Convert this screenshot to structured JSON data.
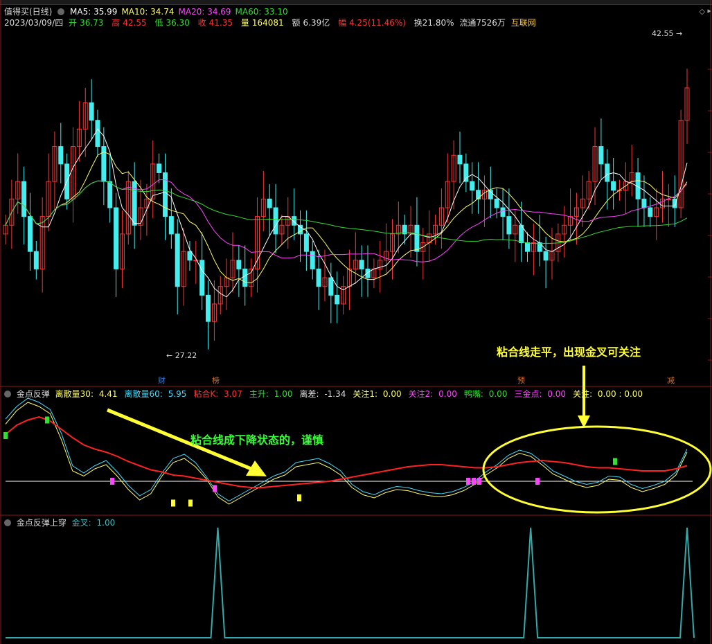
{
  "window": {
    "title": "值得买(日线)"
  },
  "ma_legend": [
    {
      "label": "MA5: 35.99",
      "color": "#ffffff"
    },
    {
      "label": "MA10: 34.74",
      "color": "#ffff66"
    },
    {
      "label": "MA20: 34.69",
      "color": "#ff44ff"
    },
    {
      "label": "MA60: 33.10",
      "color": "#33dd33"
    }
  ],
  "quote": {
    "date": "2023/03/09/四",
    "open_label": "开",
    "open": "36.73",
    "high_label": "高",
    "high": "42.55",
    "low_label": "低",
    "low": "36.30",
    "close_label": "收",
    "close": "41.35",
    "vol_label": "量",
    "vol": "164081",
    "amt_label": "额",
    "amt": "6.39亿",
    "chg_label": "幅",
    "chg": "4.25(11.46%)",
    "turnover": "换21.80%",
    "float": "流通7526万",
    "sector": "互联网"
  },
  "markers": {
    "max_price": "42.55",
    "min_price": "27.22"
  },
  "event_badges": [
    {
      "text": "财",
      "color": "#3a7bd5"
    },
    {
      "text": "榜",
      "color": "#d07030"
    },
    {
      "text": "预",
      "color": "#d07030"
    },
    {
      "text": "减",
      "color": "#d07030"
    }
  ],
  "indicator1": {
    "name": "金点反弹",
    "items": [
      {
        "label": "离散量30:",
        "value": "4.41",
        "color": "#ffff66"
      },
      {
        "label": "离散量60:",
        "value": "5.95",
        "color": "#44ddff"
      },
      {
        "label": "粘合K:",
        "value": "3.07",
        "color": "#ff3333"
      },
      {
        "label": "主升:",
        "value": "1.00",
        "color": "#33dd33"
      },
      {
        "label": "离差:",
        "value": "-1.34",
        "color": "#dddddd"
      },
      {
        "label": "关注1:",
        "value": "0.00",
        "color": "#ffff66"
      },
      {
        "label": "关注2:",
        "value": "0.00",
        "color": "#ff44ff"
      },
      {
        "label": "鸭嘴:",
        "value": "0.00",
        "color": "#33dd33"
      },
      {
        "label": "三金点:",
        "value": "0.00",
        "color": "#ff44ff"
      },
      {
        "label": "关注:",
        "value": "0.00 : 0.00",
        "color": "#ffff66"
      }
    ]
  },
  "indicator2": {
    "name": "金点反弹上穿",
    "items": [
      {
        "label": "金叉:",
        "value": "1.00",
        "color": "#44bbbb"
      }
    ]
  },
  "annotations": {
    "falling": "粘合线成下降状态的，谨慎",
    "flat": "粘合线走平，出现金叉可关注"
  },
  "colors": {
    "up": "#ff3333",
    "down": "#44eeee",
    "ma5": "#ffffff",
    "ma10": "#ffff66",
    "ma20": "#ff44ff",
    "ma60": "#33dd33",
    "ann_green": "#33ff33",
    "ann_yellow": "#ffff33"
  },
  "chart_data": [
    {
      "type": "candlestick",
      "title": "值得买(日线)",
      "ylim": [
        25,
        44
      ],
      "approx_closes": [
        33.5,
        35,
        36,
        34,
        32,
        31,
        34,
        36,
        38,
        37,
        35,
        38,
        39,
        40.5,
        39.5,
        38,
        36,
        34.5,
        31,
        33,
        36,
        33.5,
        34.5,
        35,
        37,
        36.5,
        34,
        33,
        30,
        32,
        31.5,
        31.5,
        29.5,
        28,
        29,
        30,
        30.5,
        31.5,
        31,
        30,
        31,
        34,
        35,
        34.5,
        33,
        33.5,
        34,
        33.5,
        33,
        32,
        31,
        30,
        30.5,
        29.5,
        29,
        30,
        31,
        31.5,
        31,
        30.5,
        31,
        31.5,
        32,
        33,
        33.5,
        33,
        33.5,
        32,
        32.5,
        33,
        33.5,
        34.5,
        36,
        37.5,
        37,
        36,
        35.5,
        35,
        35.5,
        35,
        34.5,
        34,
        33,
        33.5,
        32.5,
        32,
        32.5,
        32,
        31.5,
        32,
        33,
        33.5,
        34,
        34.5,
        35,
        36,
        38,
        37,
        36,
        35.5,
        35.5,
        36,
        36.5,
        35,
        34.5,
        34,
        34.5,
        35,
        35,
        34.5,
        39.5,
        41.35
      ],
      "series": [
        {
          "name": "MA5",
          "value": 35.99
        },
        {
          "name": "MA10",
          "value": 34.74
        },
        {
          "name": "MA20",
          "value": 34.69
        },
        {
          "name": "MA60",
          "value": 33.1
        }
      ],
      "annotations": [
        "42.55",
        "27.22"
      ]
    },
    {
      "type": "line",
      "title": "金点反弹",
      "ylim": [
        -3,
        8
      ],
      "series": [
        {
          "name": "离散量30",
          "values": [
            5.5,
            6.8,
            7.6,
            7.2,
            6.5,
            4,
            1,
            0.5,
            1.2,
            1.6,
            0.5,
            -0.8,
            -1.8,
            -1.2,
            0.5,
            1.8,
            2.2,
            1.4,
            0.2,
            -1.5,
            -2.2,
            -1.6,
            -1.0,
            -0.4,
            0.2,
            0.6,
            1.4,
            1.6,
            1.8,
            1.3,
            0.6,
            -0.6,
            -1.3,
            -1.6,
            -1.1,
            -0.8,
            -0.9,
            -1.2,
            -1.4,
            -1.5,
            -1.3,
            -0.9,
            -0.3,
            0.6,
            1.3,
            2.2,
            2.7,
            2.4,
            1.6,
            0.7,
            0.2,
            -0.3,
            -0.6,
            -0.4,
            0.2,
            0.1,
            -0.6,
            -1.0,
            -0.7,
            -0.3,
            0.6,
            2.8
          ]
        },
        {
          "name": "离散量60",
          "values": [
            6,
            7.2,
            8,
            7.6,
            6.9,
            4.6,
            1.5,
            0.8,
            1.5,
            2.0,
            0.9,
            -0.4,
            -1.4,
            -0.8,
            0.8,
            2.2,
            2.6,
            1.8,
            0.4,
            -1.2,
            -1.9,
            -1.3,
            -0.7,
            -0.1,
            0.5,
            0.9,
            1.8,
            2.0,
            2.2,
            1.7,
            1.0,
            -0.3,
            -1.0,
            -1.3,
            -0.8,
            -0.5,
            -0.6,
            -0.9,
            -1.1,
            -1.2,
            -1.0,
            -0.6,
            0.0,
            0.9,
            1.6,
            2.5,
            3.0,
            2.7,
            1.9,
            1.0,
            0.5,
            0.0,
            -0.3,
            -0.1,
            0.5,
            0.4,
            -0.3,
            -0.7,
            -0.4,
            0.0,
            0.9,
            3.1
          ]
        },
        {
          "name": "粘合K",
          "values": [
            4.5,
            5.4,
            5.9,
            6.2,
            5.8,
            5.0,
            4.2,
            3.5,
            3.1,
            2.8,
            2.4,
            1.9,
            1.5,
            1.1,
            0.9,
            0.6,
            0.5,
            0.3,
            0.1,
            -0.1,
            -0.3,
            -0.5,
            -0.6,
            -0.6,
            -0.5,
            -0.4,
            -0.3,
            -0.2,
            -0.1,
            0.0,
            0.2,
            0.4,
            0.6,
            0.8,
            1.0,
            1.2,
            1.4,
            1.5,
            1.6,
            1.6,
            1.5,
            1.4,
            1.3,
            1.3,
            1.4,
            1.6,
            1.8,
            1.9,
            2.0,
            1.9,
            1.8,
            1.6,
            1.4,
            1.3,
            1.3,
            1.2,
            1.1,
            1.0,
            1.0,
            1.0,
            1.2,
            1.5
          ]
        },
        {
          "name": "金叉",
          "values": [
            0,
            0,
            0,
            0,
            0,
            0,
            0,
            0,
            0,
            0,
            0,
            0,
            0,
            0,
            0,
            0,
            0,
            0,
            0,
            1,
            0,
            0,
            0,
            0,
            0,
            0,
            0,
            0,
            0,
            0,
            0,
            0,
            0,
            0,
            0,
            0,
            0,
            0,
            0,
            0,
            0,
            0,
            0,
            0,
            0,
            0,
            0,
            1,
            0,
            0,
            0,
            0,
            0,
            0,
            0,
            0,
            0,
            0,
            0,
            0,
            0,
            1
          ]
        }
      ]
    }
  ]
}
